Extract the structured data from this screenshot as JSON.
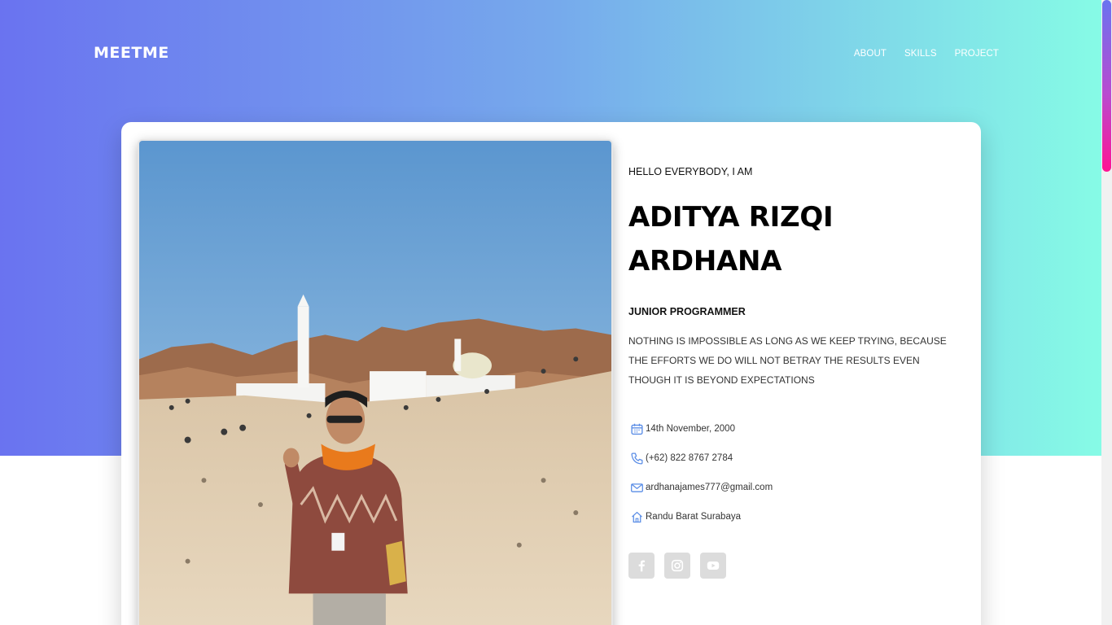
{
  "brand": {
    "logo_text": "MEETME"
  },
  "nav": {
    "items": [
      "ABOUT",
      "SKILLS",
      "PROJECT"
    ]
  },
  "profile": {
    "greeting": "HELLO EVERYBODY, I AM",
    "name_line1": "ADITYA RIZQI",
    "name_line2": "ARDHANA",
    "role": "JUNIOR PROGRAMMER",
    "quote": "NOTHING IS IMPOSSIBLE AS LONG AS WE KEEP TRYING, BECAUSE THE EFFORTS WE DO WILL NOT BETRAY THE RESULTS EVEN THOUGH IT IS BEYOND EXPECTATIONS",
    "details": {
      "birthday": {
        "icon": "calendar-icon",
        "text": "14th November, 2000"
      },
      "phone": {
        "icon": "phone-icon",
        "text": "(+62) 822 8767 2784"
      },
      "email": {
        "icon": "mail-icon",
        "text": "ardhanajames777@gmail.com"
      },
      "address": {
        "icon": "home-icon",
        "text": "Randu Barat Surabaya"
      }
    },
    "socials": [
      "facebook-icon",
      "instagram-icon",
      "youtube-icon"
    ]
  },
  "colors": {
    "gradient_start": "#6a73f0",
    "gradient_end": "#86fbe6",
    "icon_blue": "#5a8de6",
    "social_bg": "#dcdcdc"
  }
}
